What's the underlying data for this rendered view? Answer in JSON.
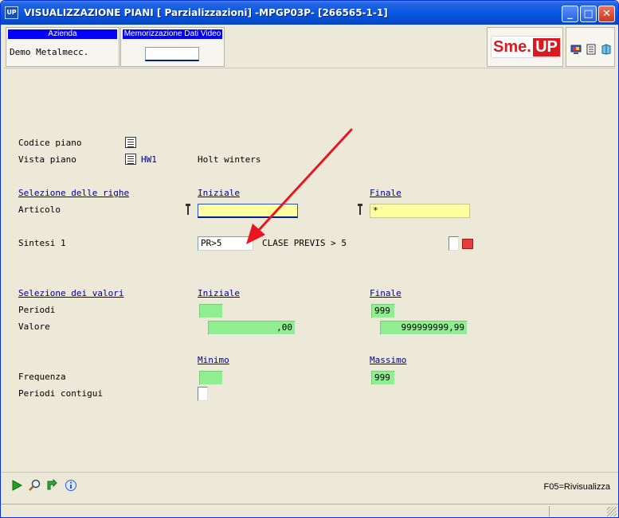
{
  "window": {
    "app_icon": "UP",
    "title": "VISUALIZZAZIONE PIANI [ Parzializzazioni] -MPGP03P- [266565-1-1]",
    "controls": {
      "minimize": "_",
      "maximize": "□",
      "close": "✕"
    }
  },
  "header": {
    "azienda_label": "Azienda",
    "azienda_value": "Demo Metalmecc.",
    "memo_label": "Memorizzazione Dati Video",
    "memo_value": "",
    "logo_left": "Sme.",
    "logo_right": "UP",
    "tool_icons": [
      "monitor-icon",
      "notes-icon",
      "book-icon"
    ]
  },
  "form": {
    "codice_piano_label": "Codice piano",
    "vista_piano_label": "Vista piano",
    "vista_piano_code": "HW1",
    "vista_piano_desc": "Holt winters",
    "righe_section": "Selezione delle righe",
    "iniziale_header": "Iniziale",
    "finale_header": "Finale",
    "articolo_label": "Articolo",
    "articolo_iniziale": "",
    "articolo_finale": "*",
    "sintesi_label": "Sintesi 1",
    "sintesi_value": "PR>5",
    "sintesi_desc": "CLASE PREVIS > 5",
    "valori_section": "Selezione dei valori",
    "valori_iniziale_header": "Iniziale",
    "valori_finale_header": "Finale",
    "periodi_label": "Periodi",
    "periodi_iniziale": "",
    "periodi_finale": "999",
    "valore_label": "Valore",
    "valore_iniziale": ",00",
    "valore_finale": "999999999,99",
    "minimo_header": "Minimo",
    "massimo_header": "Massimo",
    "frequenza_label": "Frequenza",
    "frequenza_minimo": "",
    "frequenza_massimo": "999",
    "contigui_label": "Periodi contigui"
  },
  "footer": {
    "icons": [
      "play-icon",
      "search-icon",
      "refresh-icon",
      "info-icon"
    ],
    "fkey": "F05=Rivisualizza"
  },
  "colors": {
    "title_bar": "#0A5AE4",
    "section_text": "#00008B",
    "yellow_field": "#FFFFA0",
    "green_field": "#90EE90",
    "arrow": "#E8171F",
    "brand_red": "#D91A22"
  }
}
